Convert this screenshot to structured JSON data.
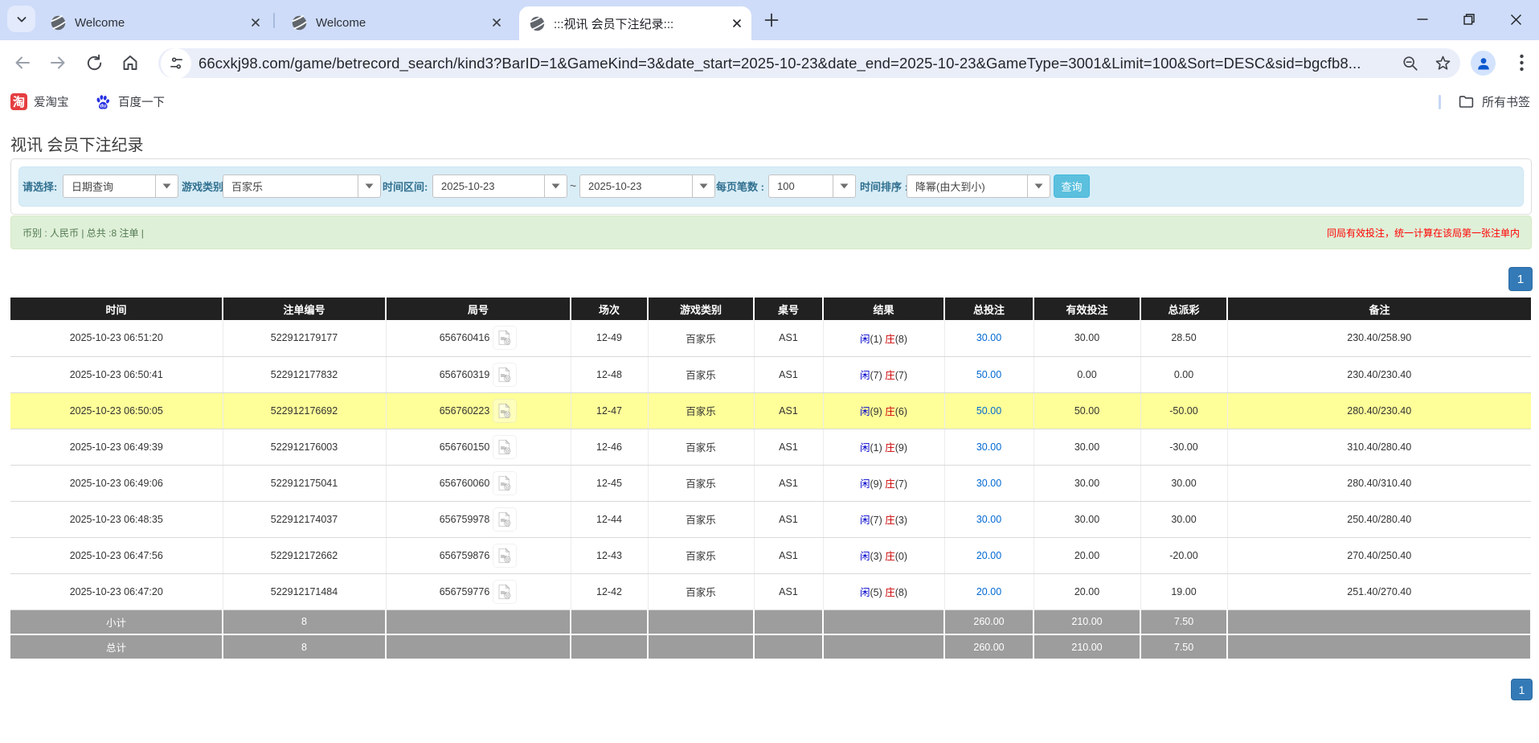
{
  "browser": {
    "tabs": [
      {
        "title": "Welcome"
      },
      {
        "title": "Welcome"
      },
      {
        "title": ":::视讯 会员下注纪录:::"
      }
    ],
    "url": "66cxkj98.com/game/betrecord_search/kind3?BarID=1&GameKind=3&date_start=2025-10-23&date_end=2025-10-23&GameType=3001&Limit=100&Sort=DESC&sid=bgcfb8...",
    "bookmarks": {
      "taobao": "爱淘宝",
      "baidu": "百度一下",
      "all_bookmarks": "所有书签",
      "taobao_icon_char": "淘"
    }
  },
  "page": {
    "title": "视讯 会员下注纪录",
    "filters": {
      "select_label": "请选择:",
      "select_value": "日期查询",
      "game_label": "游戏类别",
      "game_value": "百家乐",
      "range_label": "时间区间:",
      "date_start": "2025-10-23",
      "date_end": "2025-10-23",
      "tilde": "~",
      "page_size_label": "每页笔数 :",
      "page_size_value": "100",
      "sort_label": "时间排序 :",
      "sort_value": "降幂(由大到小)",
      "search_button": "查询"
    },
    "summary_bar": {
      "left": "币别 : 人民币 | 总共 :8 注单 |",
      "right": "同局有效投注，统一计算在该局第一张注单内"
    },
    "pagination": "1",
    "table": {
      "headers": [
        "时间",
        "注单编号",
        "局号",
        "场次",
        "游戏类别",
        "桌号",
        "结果",
        "总投注",
        "有效投注",
        "总派彩",
        "备注"
      ],
      "rows": [
        {
          "time": "2025-10-23 06:51:20",
          "bet_id": "522912179177",
          "round_id": "656760416",
          "session": "12-49",
          "game": "百家乐",
          "table": "AS1",
          "player": "闲",
          "player_pts": "(1)",
          "banker": "庄",
          "banker_pts": "(8)",
          "total_bet": "30.00",
          "valid_bet": "30.00",
          "payout": "28.50",
          "note": "230.40/258.90",
          "highlighted": false
        },
        {
          "time": "2025-10-23 06:50:41",
          "bet_id": "522912177832",
          "round_id": "656760319",
          "session": "12-48",
          "game": "百家乐",
          "table": "AS1",
          "player": "闲",
          "player_pts": "(7)",
          "banker": "庄",
          "banker_pts": "(7)",
          "total_bet": "50.00",
          "valid_bet": "0.00",
          "payout": "0.00",
          "note": "230.40/230.40",
          "highlighted": false
        },
        {
          "time": "2025-10-23 06:50:05",
          "bet_id": "522912176692",
          "round_id": "656760223",
          "session": "12-47",
          "game": "百家乐",
          "table": "AS1",
          "player": "闲",
          "player_pts": "(9)",
          "banker": "庄",
          "banker_pts": "(6)",
          "total_bet": "50.00",
          "valid_bet": "50.00",
          "payout": "-50.00",
          "note": "280.40/230.40",
          "highlighted": true
        },
        {
          "time": "2025-10-23 06:49:39",
          "bet_id": "522912176003",
          "round_id": "656760150",
          "session": "12-46",
          "game": "百家乐",
          "table": "AS1",
          "player": "闲",
          "player_pts": "(1)",
          "banker": "庄",
          "banker_pts": "(9)",
          "total_bet": "30.00",
          "valid_bet": "30.00",
          "payout": "-30.00",
          "note": "310.40/280.40",
          "highlighted": false
        },
        {
          "time": "2025-10-23 06:49:06",
          "bet_id": "522912175041",
          "round_id": "656760060",
          "session": "12-45",
          "game": "百家乐",
          "table": "AS1",
          "player": "闲",
          "player_pts": "(9)",
          "banker": "庄",
          "banker_pts": "(7)",
          "total_bet": "30.00",
          "valid_bet": "30.00",
          "payout": "30.00",
          "note": "280.40/310.40",
          "highlighted": false
        },
        {
          "time": "2025-10-23 06:48:35",
          "bet_id": "522912174037",
          "round_id": "656759978",
          "session": "12-44",
          "game": "百家乐",
          "table": "AS1",
          "player": "闲",
          "player_pts": "(7)",
          "banker": "庄",
          "banker_pts": "(3)",
          "total_bet": "30.00",
          "valid_bet": "30.00",
          "payout": "30.00",
          "note": "250.40/280.40",
          "highlighted": false
        },
        {
          "time": "2025-10-23 06:47:56",
          "bet_id": "522912172662",
          "round_id": "656759876",
          "session": "12-43",
          "game": "百家乐",
          "table": "AS1",
          "player": "闲",
          "player_pts": "(3)",
          "banker": "庄",
          "banker_pts": "(0)",
          "total_bet": "20.00",
          "valid_bet": "20.00",
          "payout": "-20.00",
          "note": "270.40/250.40",
          "highlighted": false
        },
        {
          "time": "2025-10-23 06:47:20",
          "bet_id": "522912171484",
          "round_id": "656759776",
          "session": "12-42",
          "game": "百家乐",
          "table": "AS1",
          "player": "闲",
          "player_pts": "(5)",
          "banker": "庄",
          "banker_pts": "(8)",
          "total_bet": "20.00",
          "valid_bet": "20.00",
          "payout": "19.00",
          "note": "251.40/270.40",
          "highlighted": false
        }
      ],
      "subtotal": {
        "label": "小计",
        "count": "8",
        "total_bet": "260.00",
        "valid_bet": "210.00",
        "payout": "7.50"
      },
      "total": {
        "label": "总计",
        "count": "8",
        "total_bet": "260.00",
        "valid_bet": "210.00",
        "payout": "7.50"
      }
    }
  }
}
